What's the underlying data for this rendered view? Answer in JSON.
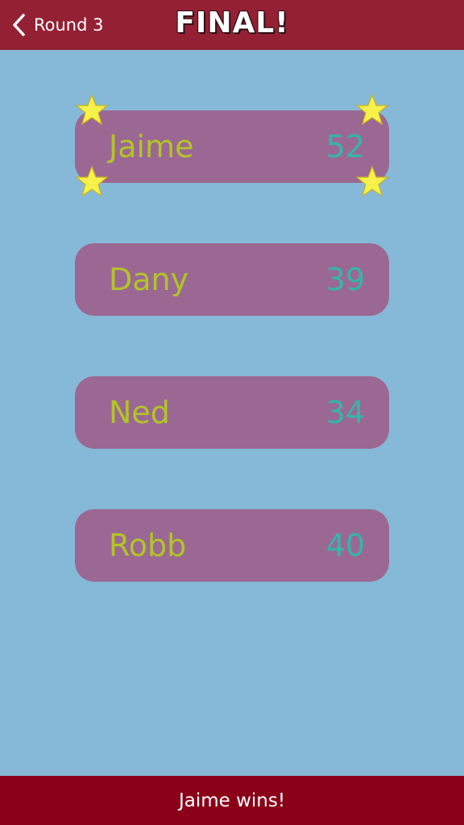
{
  "header": {
    "back_label": "Round 3",
    "title": "FINAL!"
  },
  "players": [
    {
      "name": "Jaime",
      "score": "52",
      "winner": true
    },
    {
      "name": "Dany",
      "score": "39",
      "winner": false
    },
    {
      "name": "Ned",
      "score": "34",
      "winner": false
    },
    {
      "name": "Robb",
      "score": "40",
      "winner": false
    }
  ],
  "footer": {
    "message": "Jaime wins!"
  },
  "icons": {
    "back": "chevron-left-icon",
    "winner_marker": "star-icon"
  },
  "colors": {
    "header_bg": "#942034",
    "footer_bg": "#8b0019",
    "page_bg": "#86b8d7",
    "row_bg": "#9b6893",
    "name_color": "#b2c427",
    "score_color": "#34b6a9",
    "star_fill": "#f7f14a"
  }
}
